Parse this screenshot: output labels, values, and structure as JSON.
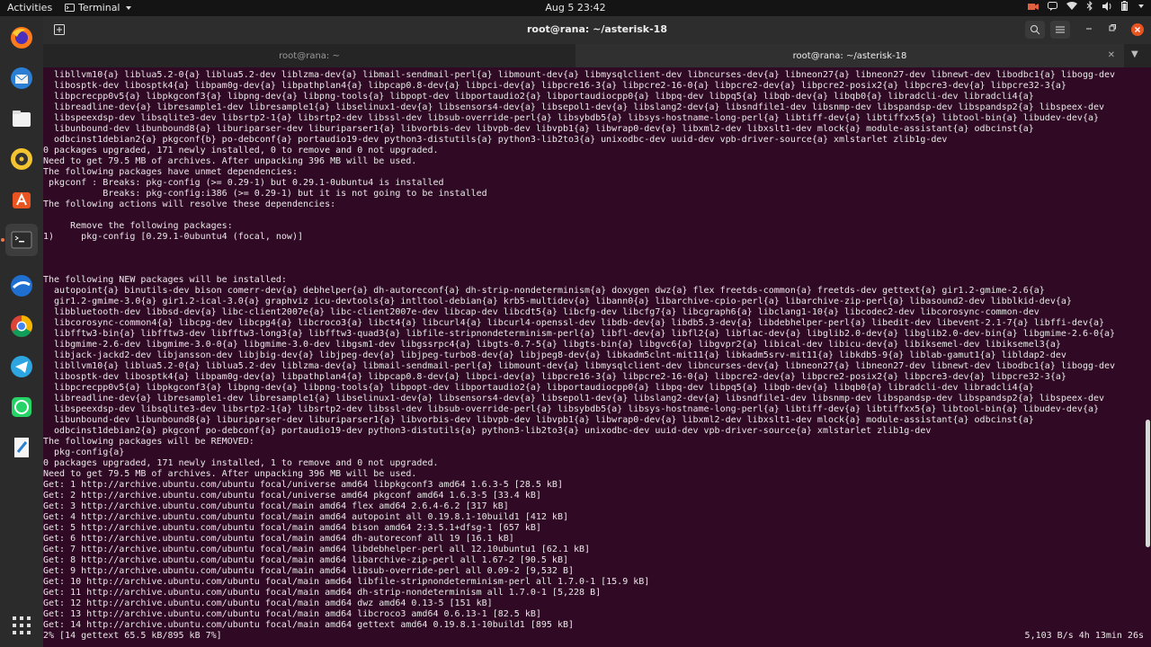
{
  "topbar": {
    "activities": "Activities",
    "app_name": "Terminal",
    "clock": "Aug 5  23:42"
  },
  "dock": {
    "items": [
      "firefox-icon",
      "thunderbird-icon",
      "files-icon",
      "rhythmbox-icon",
      "software-center-icon",
      "terminal-icon",
      "pycharm-icon",
      "chrome-icon",
      "telegram-icon",
      "whatsapp-icon",
      "text-editor-icon"
    ],
    "apps_grid": "show-applications-icon"
  },
  "window": {
    "title": "root@rana: ~/asterisk-18",
    "tabs": [
      {
        "label": "root@rana: ~",
        "active": false
      },
      {
        "label": "root@rana: ~/asterisk-18",
        "active": true
      }
    ]
  },
  "terminal": {
    "lines": [
      "  libllvm10{a} liblua5.2-0{a} liblua5.2-dev liblzma-dev{a} libmail-sendmail-perl{a} libmount-dev{a} libmysqlclient-dev libncurses-dev{a} libneon27{a} libneon27-dev libnewt-dev libodbc1{a} libogg-dev",
      "  libosptk-dev libosptk4{a} libpam0g-dev{a} libpathplan4{a} libpcap0.8-dev{a} libpci-dev{a} libpcre16-3{a} libpcre2-16-0{a} libpcre2-dev{a} libpcre2-posix2{a} libpcre3-dev{a} libpcre32-3{a}",
      "  libpcrecpp0v5{a} libpkgconf3{a} libpng-dev{a} libpng-tools{a} libpopt-dev libportaudio2{a} libportaudiocpp0{a} libpq-dev libpq5{a} libqb-dev{a} libqb0{a} libradcli-dev libradcli4{a}",
      "  libreadline-dev{a} libresample1-dev libresample1{a} libselinux1-dev{a} libsensors4-dev{a} libsepol1-dev{a} libslang2-dev{a} libsndfile1-dev libsnmp-dev libspandsp-dev libspandsp2{a} libspeex-dev",
      "  libspeexdsp-dev libsqlite3-dev libsrtp2-1{a} libsrtp2-dev libssl-dev libsub-override-perl{a} libsybdb5{a} libsys-hostname-long-perl{a} libtiff-dev{a} libtiffxx5{a} libtool-bin{a} libudev-dev{a}",
      "  libunbound-dev libunbound8{a} liburiparser-dev liburiparser1{a} libvorbis-dev libvpb-dev libvpb1{a} libwrap0-dev{a} libxml2-dev libxslt1-dev mlock{a} module-assistant{a} odbcinst{a}",
      "  odbcinst1debian2{a} pkgconf{b} po-debconf{a} portaudio19-dev python3-distutils{a} python3-lib2to3{a} unixodbc-dev uuid-dev vpb-driver-source{a} xmlstarlet zlib1g-dev",
      "0 packages upgraded, 171 newly installed, 0 to remove and 0 not upgraded.",
      "Need to get 79.5 MB of archives. After unpacking 396 MB will be used.",
      "The following packages have unmet dependencies:",
      " pkgconf : Breaks: pkg-config (>= 0.29-1) but 0.29.1-0ubuntu4 is installed",
      "           Breaks: pkg-config:i386 (>= 0.29-1) but it is not going to be installed",
      "The following actions will resolve these dependencies:",
      "",
      "     Remove the following packages:",
      "1)     pkg-config [0.29.1-0ubuntu4 (focal, now)]",
      "",
      "",
      "",
      "The following NEW packages will be installed:",
      "  autopoint{a} binutils-dev bison comerr-dev{a} debhelper{a} dh-autoreconf{a} dh-strip-nondeterminism{a} doxygen dwz{a} flex freetds-common{a} freetds-dev gettext{a} gir1.2-gmime-2.6{a}",
      "  gir1.2-gmime-3.0{a} gir1.2-ical-3.0{a} graphviz icu-devtools{a} intltool-debian{a} krb5-multidev{a} libann0{a} libarchive-cpio-perl{a} libarchive-zip-perl{a} libasound2-dev libblkid-dev{a}",
      "  libbluetooth-dev libbsd-dev{a} libc-client2007e{a} libc-client2007e-dev libcap-dev libcdt5{a} libcfg-dev libcfg7{a} libcgraph6{a} libclang1-10{a} libcodec2-dev libcorosync-common-dev",
      "  libcorosync-common4{a} libcpg-dev libcpg4{a} libcroco3{a} libct4{a} libcurl4{a} libcurl4-openssl-dev libdb-dev{a} libdb5.3-dev{a} libdebhelper-perl{a} libedit-dev libevent-2.1-7{a} libffi-dev{a}",
      "  libfftw3-bin{a} libfftw3-dev libfftw3-long3{a} libfftw3-quad3{a} libfile-stripnondeterminism-perl{a} libfl-dev{a} libfl2{a} libflac-dev{a} libglib2.0-dev{a} libglib2.0-dev-bin{a} libgmime-2.6-0{a}",
      "  libgmime-2.6-dev libgmime-3.0-0{a} libgmime-3.0-dev libgsm1-dev libgssrpc4{a} libgts-0.7-5{a} libgts-bin{a} libgvc6{a} libgvpr2{a} libical-dev libicu-dev{a} libiksemel-dev libiksemel3{a}",
      "  libjack-jackd2-dev libjansson-dev libjbig-dev{a} libjpeg-dev{a} libjpeg-turbo8-dev{a} libjpeg8-dev{a} libkadm5clnt-mit11{a} libkadm5srv-mit11{a} libkdb5-9{a} liblab-gamut1{a} libldap2-dev",
      "  libllvm10{a} liblua5.2-0{a} liblua5.2-dev liblzma-dev{a} libmail-sendmail-perl{a} libmount-dev{a} libmysqlclient-dev libncurses-dev{a} libneon27{a} libneon27-dev libnewt-dev libodbc1{a} libogg-dev",
      "  libosptk-dev libosptk4{a} libpam0g-dev{a} libpathplan4{a} libpcap0.8-dev{a} libpci-dev{a} libpcre16-3{a} libpcre2-16-0{a} libpcre2-dev{a} libpcre2-posix2{a} libpcre3-dev{a} libpcre32-3{a}",
      "  libpcrecpp0v5{a} libpkgconf3{a} libpng-dev{a} libpng-tools{a} libpopt-dev libportaudio2{a} libportaudiocpp0{a} libpq-dev libpq5{a} libqb-dev{a} libqb0{a} libradcli-dev libradcli4{a}",
      "  libreadline-dev{a} libresample1-dev libresample1{a} libselinux1-dev{a} libsensors4-dev{a} libsepol1-dev{a} libslang2-dev{a} libsndfile1-dev libsnmp-dev libspandsp-dev libspandsp2{a} libspeex-dev",
      "  libspeexdsp-dev libsqlite3-dev libsrtp2-1{a} libsrtp2-dev libssl-dev libsub-override-perl{a} libsybdb5{a} libsys-hostname-long-perl{a} libtiff-dev{a} libtiffxx5{a} libtool-bin{a} libudev-dev{a}",
      "  libunbound-dev libunbound8{a} liburiparser-dev liburiparser1{a} libvorbis-dev libvpb-dev libvpb1{a} libwrap0-dev{a} libxml2-dev libxslt1-dev mlock{a} module-assistant{a} odbcinst{a}",
      "  odbcinst1debian2{a} pkgconf po-debconf{a} portaudio19-dev python3-distutils{a} python3-lib2to3{a} unixodbc-dev uuid-dev vpb-driver-source{a} xmlstarlet zlib1g-dev",
      "The following packages will be REMOVED:",
      "  pkg-config{a}",
      "0 packages upgraded, 171 newly installed, 1 to remove and 0 not upgraded.",
      "Need to get 79.5 MB of archives. After unpacking 396 MB will be used.",
      "Get: 1 http://archive.ubuntu.com/ubuntu focal/universe amd64 libpkgconf3 amd64 1.6.3-5 [28.5 kB]",
      "Get: 2 http://archive.ubuntu.com/ubuntu focal/universe amd64 pkgconf amd64 1.6.3-5 [33.4 kB]",
      "Get: 3 http://archive.ubuntu.com/ubuntu focal/main amd64 flex amd64 2.6.4-6.2 [317 kB]",
      "Get: 4 http://archive.ubuntu.com/ubuntu focal/main amd64 autopoint all 0.19.8.1-10build1 [412 kB]",
      "Get: 5 http://archive.ubuntu.com/ubuntu focal/main amd64 bison amd64 2:3.5.1+dfsg-1 [657 kB]",
      "Get: 6 http://archive.ubuntu.com/ubuntu focal/main amd64 dh-autoreconf all 19 [16.1 kB]",
      "Get: 7 http://archive.ubuntu.com/ubuntu focal/main amd64 libdebhelper-perl all 12.10ubuntu1 [62.1 kB]",
      "Get: 8 http://archive.ubuntu.com/ubuntu focal/main amd64 libarchive-zip-perl all 1.67-2 [90.5 kB]",
      "Get: 9 http://archive.ubuntu.com/ubuntu focal/main amd64 libsub-override-perl all 0.09-2 [9,532 B]",
      "Get: 10 http://archive.ubuntu.com/ubuntu focal/main amd64 libfile-stripnondeterminism-perl all 1.7.0-1 [15.9 kB]",
      "Get: 11 http://archive.ubuntu.com/ubuntu focal/main amd64 dh-strip-nondeterminism all 1.7.0-1 [5,228 B]",
      "Get: 12 http://archive.ubuntu.com/ubuntu focal/main amd64 dwz amd64 0.13-5 [151 kB]",
      "Get: 13 http://archive.ubuntu.com/ubuntu focal/main amd64 libcroco3 amd64 0.6.13-1 [82.5 kB]",
      "Get: 14 http://archive.ubuntu.com/ubuntu focal/main amd64 gettext amd64 0.19.8.1-10build1 [895 kB]",
      "2% [14 gettext 65.5 kB/895 kB 7%]"
    ],
    "rate": "5,103 B/s 4h 13min 26s"
  },
  "scrollbar": {
    "position_fraction": 0.78,
    "visible_fraction": 0.22
  },
  "colors": {
    "terminal_bg": "#300a24",
    "accent": "#e95420",
    "text": "#e8e8e8"
  }
}
